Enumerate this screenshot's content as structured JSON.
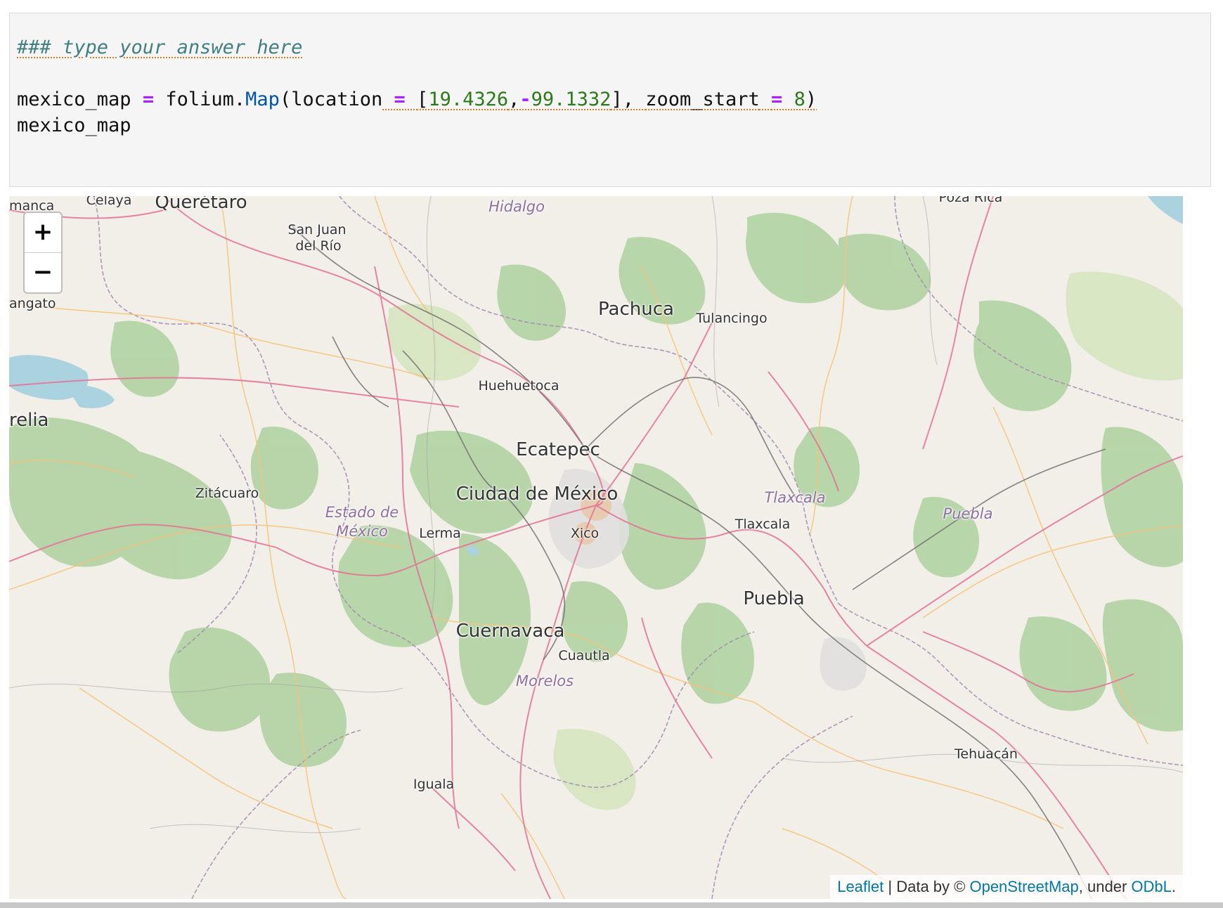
{
  "cell": {
    "comment": "### type your answer here",
    "line2": {
      "var": "mexico_map",
      "eq": "=",
      "module": "folium.",
      "func": "Map",
      "open": "(location",
      "eq2": "=",
      "bracket_open": "[",
      "lat": "19.4326",
      "comma": ",",
      "minus": "-",
      "lon": "99.1332",
      "bracket_close": "],",
      "kw": "zoom_start",
      "eq3": "=",
      "zoom": "8",
      "close": ")"
    },
    "line3": "mexico_map"
  },
  "map": {
    "zoom_in": "+",
    "zoom_out": "−",
    "labels": {
      "manca": "manca",
      "celaya": "Celaya",
      "queretaro": "Querétaro",
      "hidalgo": "Hidalgo",
      "poza_rica": "Poza Rica",
      "san_juan_1": "San Juan",
      "san_juan_2": "del Río",
      "angato": "angato",
      "pachuca": "Pachuca",
      "tulancingo": "Tulancingo",
      "huehuetoca": "Huehuetoca",
      "relia": "relia",
      "ecatepec": "Ecatepec",
      "ciudad_de_mexico": "Ciudad de México",
      "zitacuaro": "Zitácuaro",
      "estado_1": "Estado de",
      "estado_2": "México",
      "lerma": "Lerma",
      "xico": "Xico",
      "tlaxcala_state": "Tlaxcala",
      "tlaxcala": "Tlaxcala",
      "puebla_state": "Puebla",
      "puebla": "Puebla",
      "cuernavaca": "Cuernavaca",
      "cuautla": "Cuautla",
      "morelos": "Morelos",
      "iguala": "Iguala",
      "tehuacan": "Tehuacán"
    },
    "attribution": {
      "leaflet": "Leaflet",
      "sep": " | Data by © ",
      "osm": "OpenStreetMap",
      "under": ", under ",
      "odbl": "ODbL",
      "end": "."
    }
  }
}
